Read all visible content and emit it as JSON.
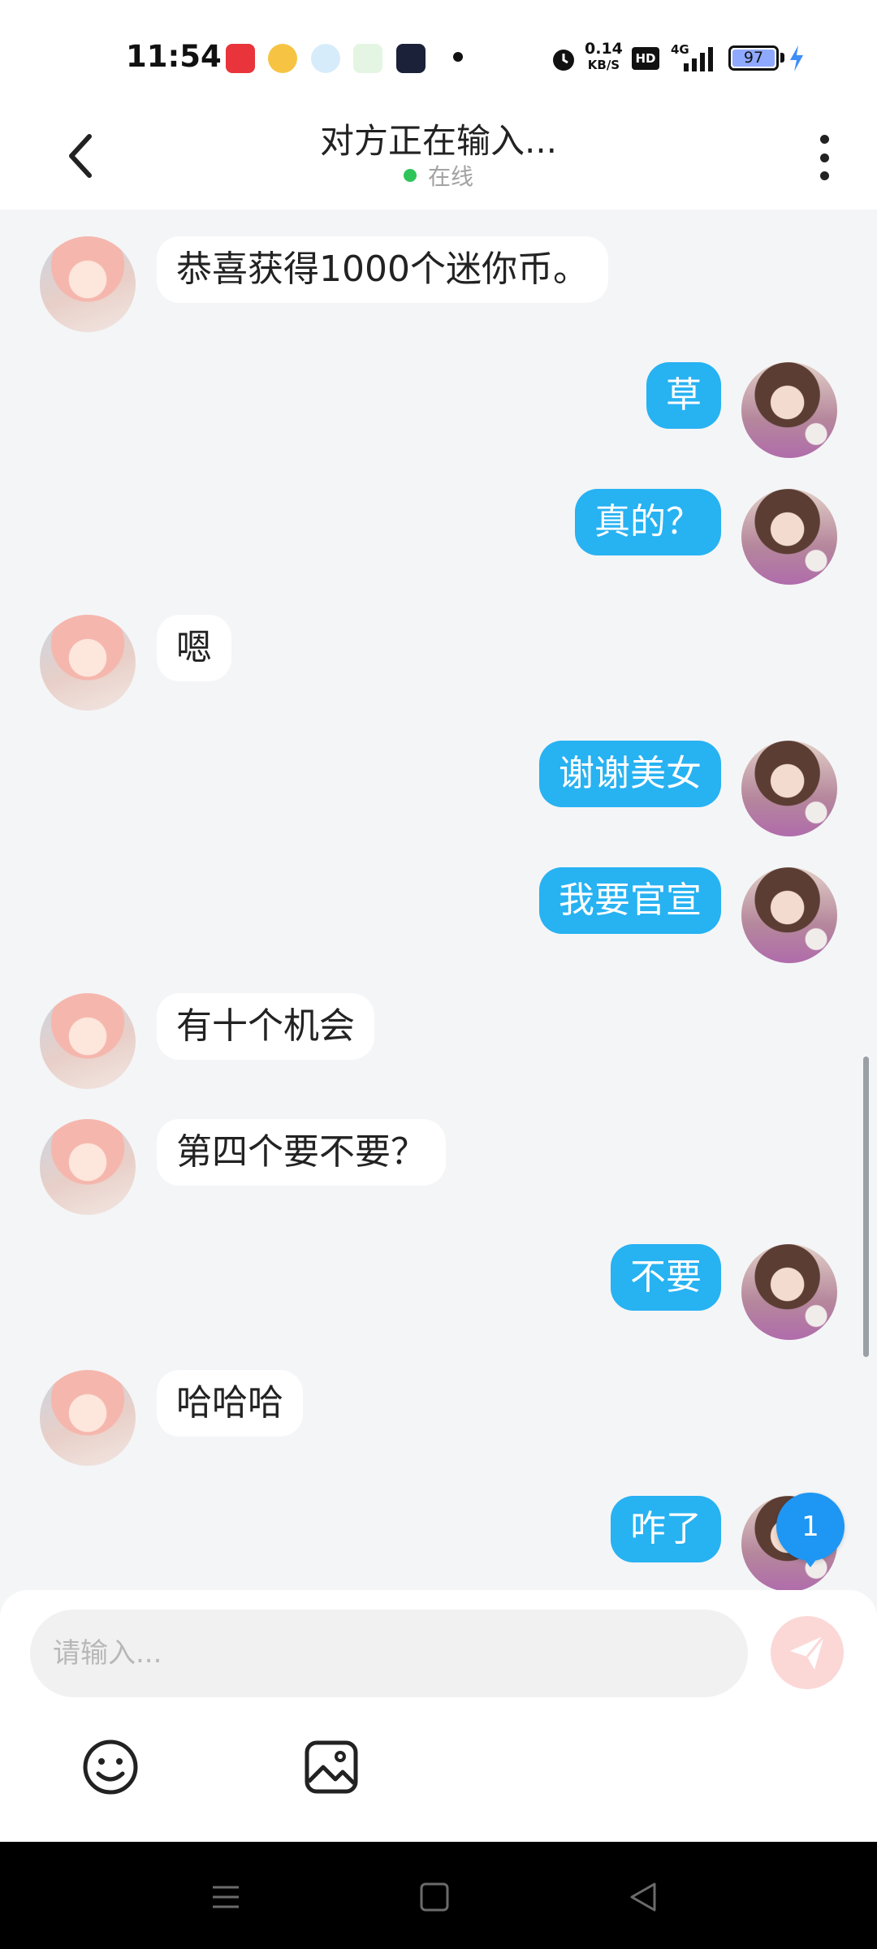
{
  "status_bar": {
    "time": "11:54",
    "app_icons": [
      "toutiao-icon",
      "weibo-icon",
      "browser-icon",
      "video-icon",
      "kwai-icon"
    ],
    "net_speed_value": "0.14",
    "net_speed_unit": "KB/S",
    "hd": "HD",
    "network": "4G",
    "battery": "97"
  },
  "header": {
    "title": "对方正在输入...",
    "status": "在线"
  },
  "messages": [
    {
      "side": "in",
      "text": "恭喜获得1000个迷你币。"
    },
    {
      "side": "out",
      "text": "草"
    },
    {
      "side": "out",
      "text": "真的？"
    },
    {
      "side": "in",
      "text": "嗯"
    },
    {
      "side": "out",
      "text": "谢谢美女"
    },
    {
      "side": "out",
      "text": "我要官宣"
    },
    {
      "side": "in",
      "text": "有十个机会"
    },
    {
      "side": "in",
      "text": "第四个要不要？"
    },
    {
      "side": "out",
      "text": "不要"
    },
    {
      "side": "in",
      "text": "哈哈哈"
    },
    {
      "side": "out",
      "text": "咋了"
    }
  ],
  "unread_count": "1",
  "input": {
    "placeholder": "请输入..."
  },
  "colors": {
    "accent": "#27b2f2",
    "online": "#2ec45a",
    "send_button": "#fbd8d6",
    "background": "#f4f5f7"
  }
}
